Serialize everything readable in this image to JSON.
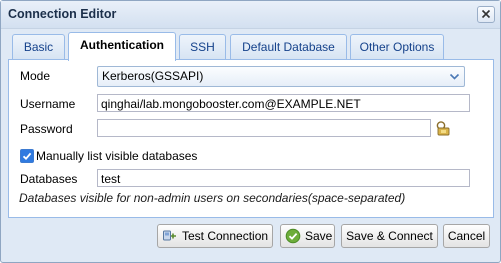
{
  "window": {
    "title": "Connection Editor"
  },
  "tabs": [
    {
      "label": "Basic"
    },
    {
      "label": "Authentication"
    },
    {
      "label": "SSH"
    },
    {
      "label": "Default Database"
    },
    {
      "label": "Other Options"
    }
  ],
  "form": {
    "mode_label": "Mode",
    "mode_value": "Kerberos(GSSAPI)",
    "username_label": "Username",
    "username_value": "qinghai/lab.mongobooster.com@EXAMPLE.NET",
    "password_label": "Password",
    "password_value": "",
    "manual_list_label": "Manually list visible databases",
    "manual_list_checked": true,
    "databases_label": "Databases",
    "databases_value": "test",
    "databases_hint": "Databases visible for non-admin users on secondaries(space-separated)"
  },
  "buttons": {
    "test_connection": "Test Connection",
    "save": "Save",
    "save_connect": "Save & Connect",
    "cancel": "Cancel"
  },
  "colors": {
    "accent": "#2f7ae0",
    "tab_text": "#15428b",
    "border": "#99bbe8"
  }
}
